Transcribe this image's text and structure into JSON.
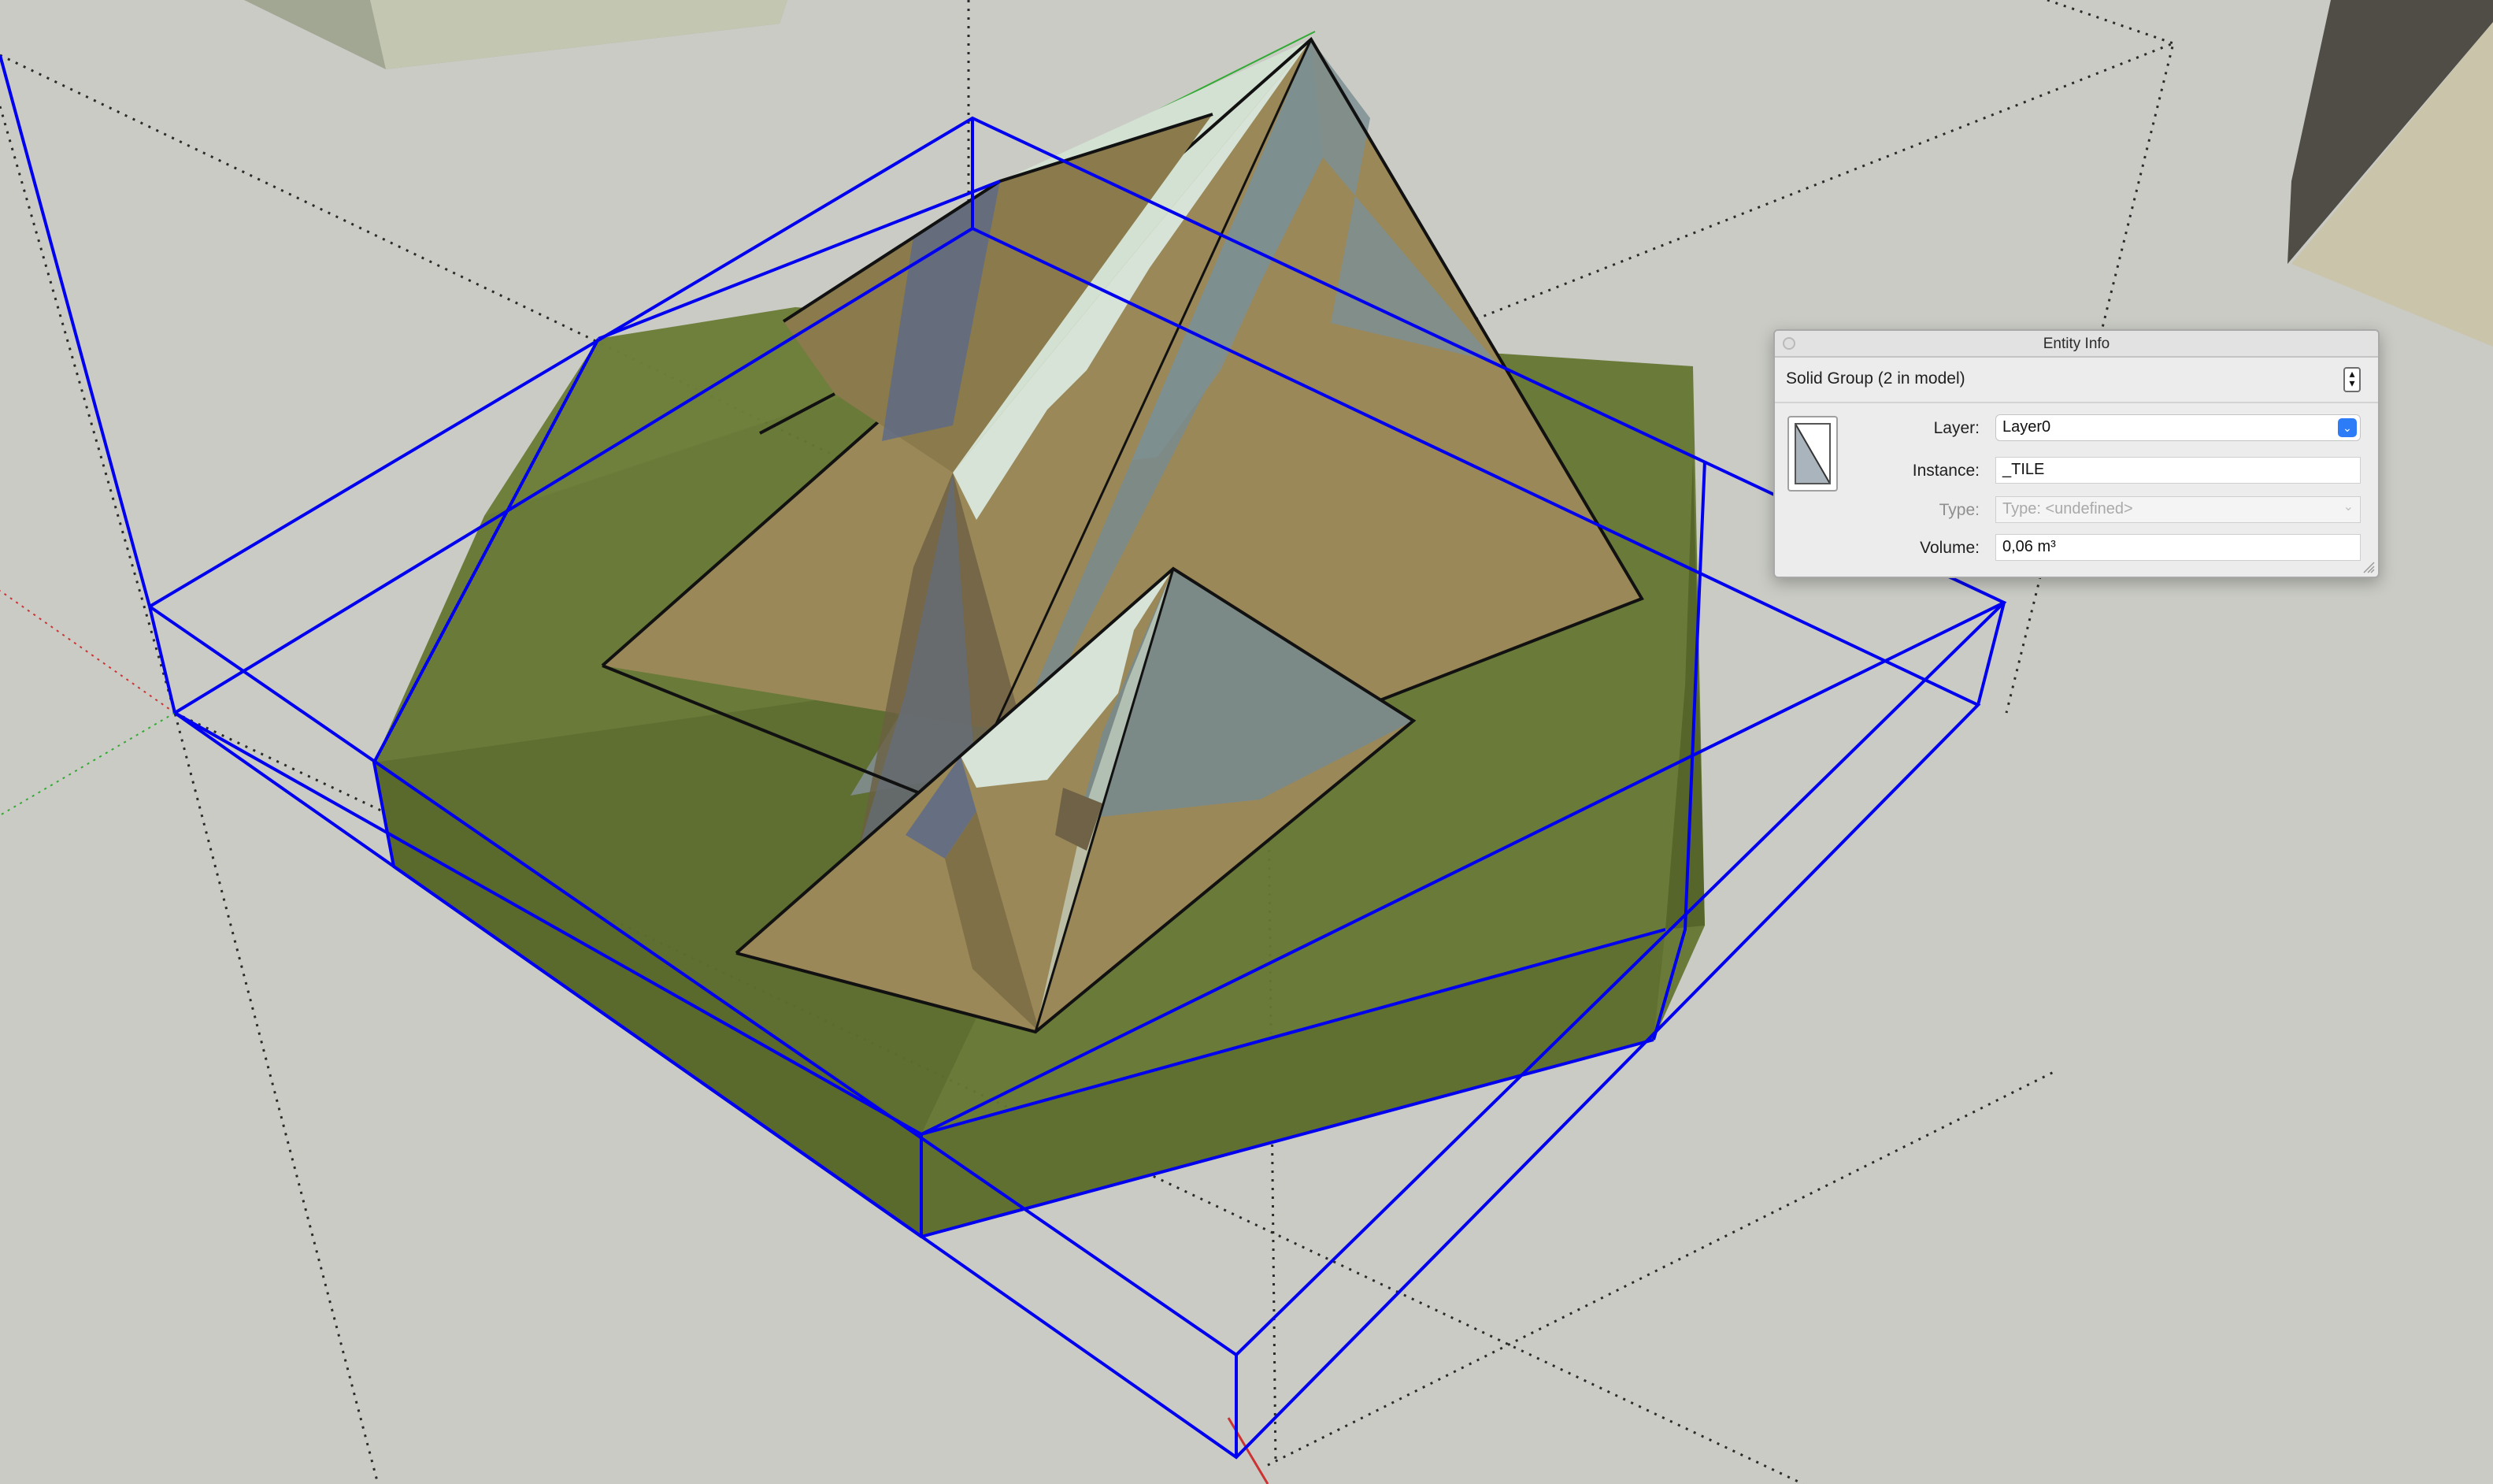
{
  "window": {
    "title": "Entity Info"
  },
  "entity": {
    "name": "Solid Group (2 in model)",
    "layer_label": "Layer:",
    "layer_value": "Layer0",
    "instance_label": "Instance:",
    "instance_value": "_TILE",
    "type_label": "Type:",
    "type_value": "Type: <undefined>",
    "volume_label": "Volume:",
    "volume_value": "0,06 m³"
  },
  "icons": {
    "close": "close-icon",
    "details_toggle": "details-toggle-icon",
    "layer_dropdown": "chevron-down-icon",
    "thumbnail": "material-swatch",
    "resize": "resize-grip-icon"
  },
  "colors": {
    "viewport_bg": "#cacbc5",
    "selection_blue": "#0000ee",
    "ground_green": "#667833",
    "rock_brown": "#9b8858",
    "snow": "#d6e3d6",
    "dropdown_accent": "#2b7cf6"
  }
}
